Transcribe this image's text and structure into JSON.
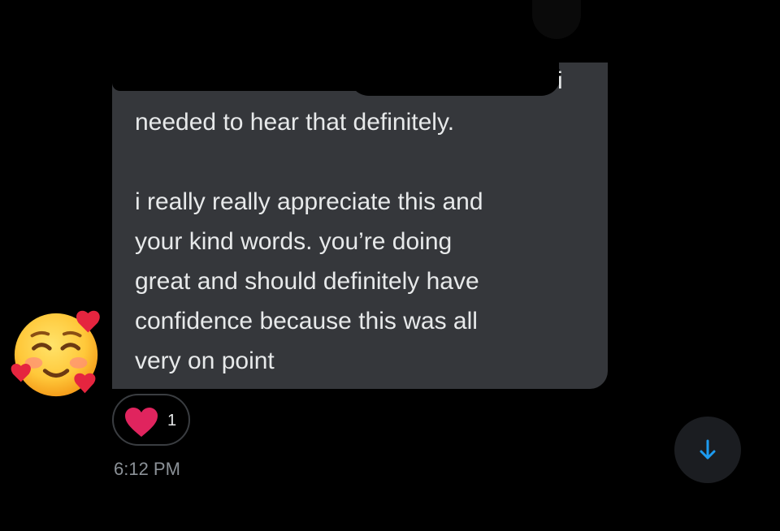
{
  "message": {
    "trailing_visible_text": "i",
    "body": "needed to hear that definitely.\n\ni really really appreciate this and\nyour kind words. you’re doing\ngreat and should definitely have\nconfidence because this was all\nvery on point",
    "timestamp": "6:12 PM"
  },
  "reaction": {
    "icon": "heart-icon",
    "count": "1",
    "color": "#e0245e"
  },
  "sender_emoji": {
    "icon": "smiling-face-with-hearts-emoji"
  },
  "scroll_button": {
    "icon": "arrow-down-icon",
    "color": "#1d9bf0"
  }
}
